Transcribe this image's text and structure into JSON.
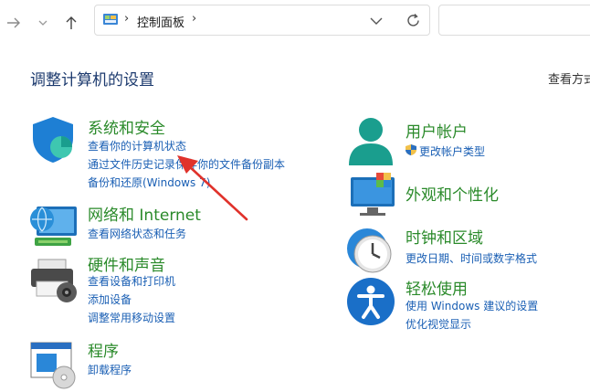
{
  "toolbar": {
    "breadcrumb_sep1": "›",
    "breadcrumb_label": "控制面板",
    "breadcrumb_sep2": "›"
  },
  "page": {
    "title": "调整计算机的设置",
    "view_by": "查看方式"
  },
  "categories": {
    "system_security": {
      "title": "系统和安全",
      "links": [
        "查看你的计算机状态",
        "通过文件历史记录保存你的文件备份副本",
        "备份和还原(Windows 7)"
      ]
    },
    "network": {
      "title": "网络和 Internet",
      "links": [
        "查看网络状态和任务"
      ]
    },
    "hardware": {
      "title": "硬件和声音",
      "links": [
        "查看设备和打印机",
        "添加设备",
        "调整常用移动设置"
      ]
    },
    "programs": {
      "title": "程序",
      "links": [
        "卸载程序"
      ]
    },
    "user_accounts": {
      "title": "用户帐户",
      "links": [
        "更改帐户类型"
      ]
    },
    "appearance": {
      "title": "外观和个性化",
      "links": []
    },
    "clock_region": {
      "title": "时钟和区域",
      "links": [
        "更改日期、时间或数字格式"
      ]
    },
    "ease_access": {
      "title": "轻松使用",
      "links": [
        "使用 Windows 建议的设置",
        "优化视觉显示"
      ]
    }
  },
  "colors": {
    "category_green": "#2a8a2a",
    "link_blue": "#1a5fb4",
    "title_navy": "#1c3a6e",
    "arrow_red": "#e0322b"
  }
}
